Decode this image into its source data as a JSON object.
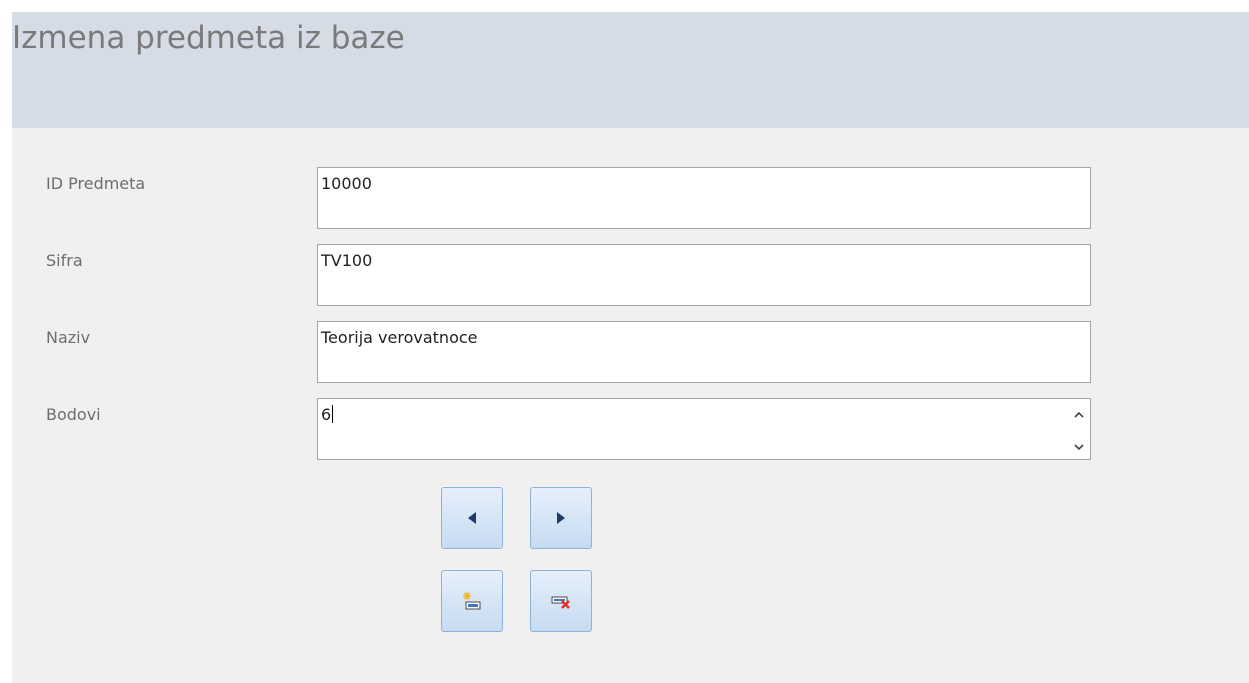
{
  "form": {
    "title": "Izmena predmeta iz baze"
  },
  "fields": [
    {
      "label": "ID Predmeta",
      "value": "10000"
    },
    {
      "label": "Sifra",
      "value": "TV100"
    },
    {
      "label": "Naziv",
      "value": "Teorija verovatnoce"
    },
    {
      "label": "Bodovi",
      "value": "6"
    }
  ],
  "buttons": {
    "previous_icon": "triangle-left-icon",
    "next_icon": "triangle-right-icon",
    "new_record_icon": "new-record-icon",
    "delete_record_icon": "delete-record-icon"
  },
  "colors": {
    "header_bg": "#d6dce5",
    "form_bg": "#f0f0f0",
    "button_border": "#8fb2d8",
    "button_fill": "#c6dbf2",
    "icon_dark": "#1f3a6b",
    "delete_red": "#e0301e"
  }
}
